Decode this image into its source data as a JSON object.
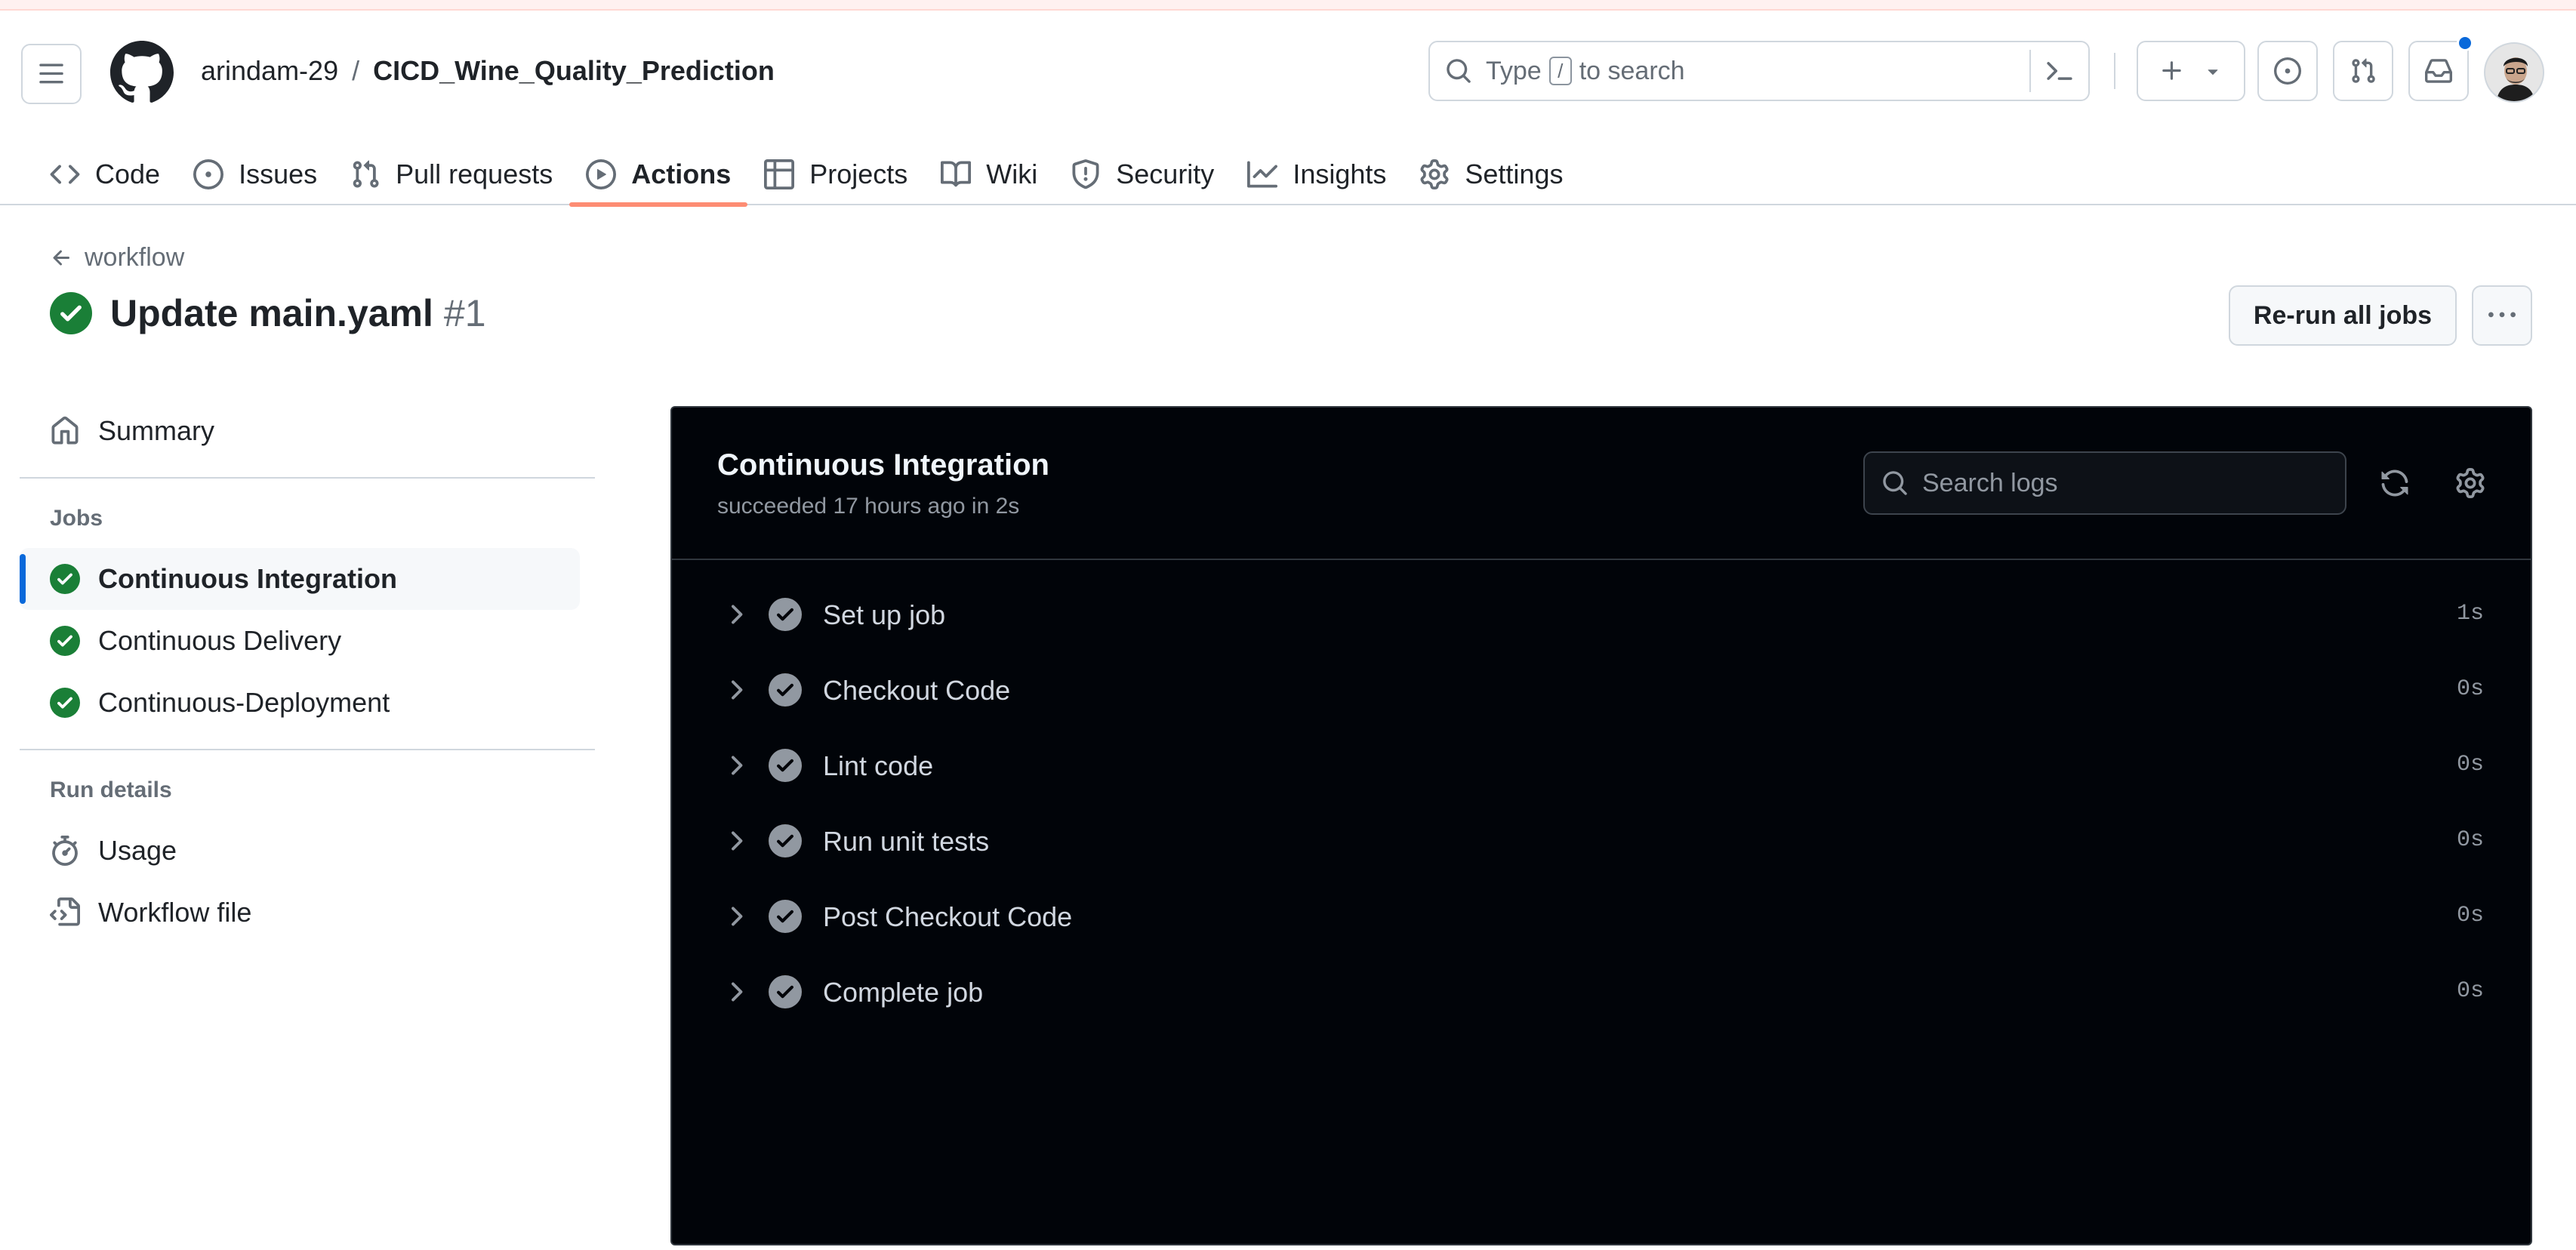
{
  "header": {
    "owner": "arindam-29",
    "separator": "/",
    "repo": "CICD_Wine_Quality_Prediction",
    "search_before_key": "Type",
    "search_key": "/",
    "search_after_key": "to search"
  },
  "tabs": [
    {
      "label": "Code",
      "icon": "code-icon"
    },
    {
      "label": "Issues",
      "icon": "issue-icon"
    },
    {
      "label": "Pull requests",
      "icon": "pull-request-icon"
    },
    {
      "label": "Actions",
      "icon": "play-icon",
      "active": true
    },
    {
      "label": "Projects",
      "icon": "table-icon"
    },
    {
      "label": "Wiki",
      "icon": "book-icon"
    },
    {
      "label": "Security",
      "icon": "shield-icon"
    },
    {
      "label": "Insights",
      "icon": "graph-icon"
    },
    {
      "label": "Settings",
      "icon": "gear-icon"
    }
  ],
  "run": {
    "back_label": "workflow",
    "title": "Update main.yaml",
    "number": "#1",
    "rerun_label": "Re-run all jobs"
  },
  "sidebar": {
    "summary_label": "Summary",
    "jobs_heading": "Jobs",
    "jobs": [
      {
        "label": "Continuous Integration",
        "status": "success",
        "active": true
      },
      {
        "label": "Continuous Delivery",
        "status": "success"
      },
      {
        "label": "Continuous-Deployment",
        "status": "success"
      }
    ],
    "run_details_heading": "Run details",
    "run_details": [
      {
        "label": "Usage",
        "icon": "stopwatch-icon"
      },
      {
        "label": "Workflow file",
        "icon": "file-code-icon"
      }
    ]
  },
  "log": {
    "job_title": "Continuous Integration",
    "job_subtitle": "succeeded 17 hours ago in 2s",
    "search_placeholder": "Search logs",
    "steps": [
      {
        "name": "Set up job",
        "duration": "1s"
      },
      {
        "name": "Checkout Code",
        "duration": "0s"
      },
      {
        "name": "Lint code",
        "duration": "0s"
      },
      {
        "name": "Run unit tests",
        "duration": "0s"
      },
      {
        "name": "Post Checkout Code",
        "duration": "0s"
      },
      {
        "name": "Complete job",
        "duration": "0s"
      }
    ]
  },
  "colors": {
    "success": "#1a7f37",
    "active_tab_underline": "#fd8c73",
    "active_job_marker": "#0969da",
    "log_background": "#010409"
  }
}
